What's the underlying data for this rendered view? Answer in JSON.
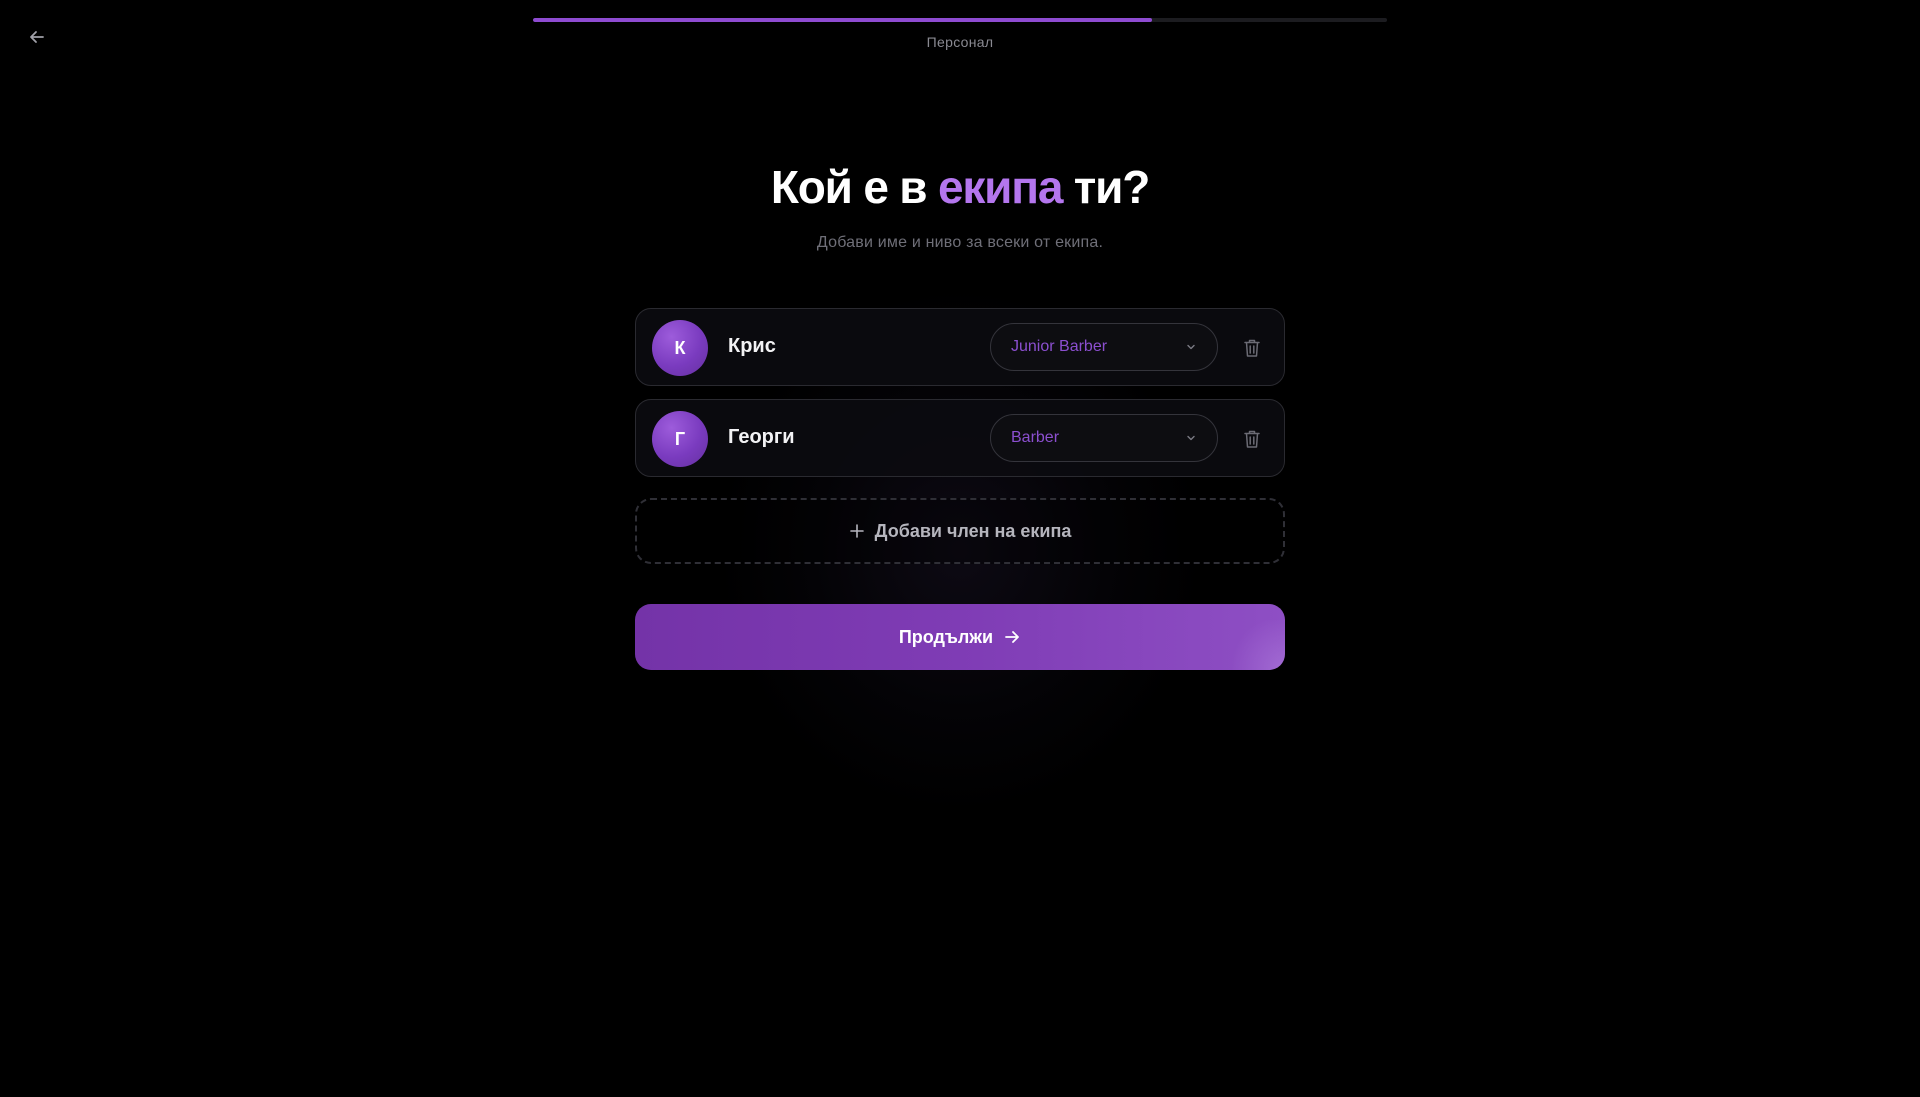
{
  "header": {
    "step_label": "Персонал",
    "progress_fraction": 0.725
  },
  "heading": {
    "title_before": "Кой е в ",
    "title_accent": "екипа",
    "title_after": " ти?",
    "subtitle": "Добави име и ниво за всеки от екипа."
  },
  "team": [
    {
      "initial": "К",
      "name": "Крис",
      "role": "Junior Barber"
    },
    {
      "initial": "Г",
      "name": "Георги",
      "role": "Barber"
    }
  ],
  "actions": {
    "add_member_label": "Добави член на екипа",
    "continue_label": "Продължи"
  },
  "colors": {
    "accent": "#b476ee",
    "primary": "#7f3cb5",
    "progress": "#8e4bd1",
    "background": "#000000"
  },
  "icons": {
    "back": "arrow-left-icon",
    "chevron": "chevron-down-icon",
    "delete": "trash-icon",
    "add": "plus-icon",
    "continue": "arrow-right-icon"
  }
}
